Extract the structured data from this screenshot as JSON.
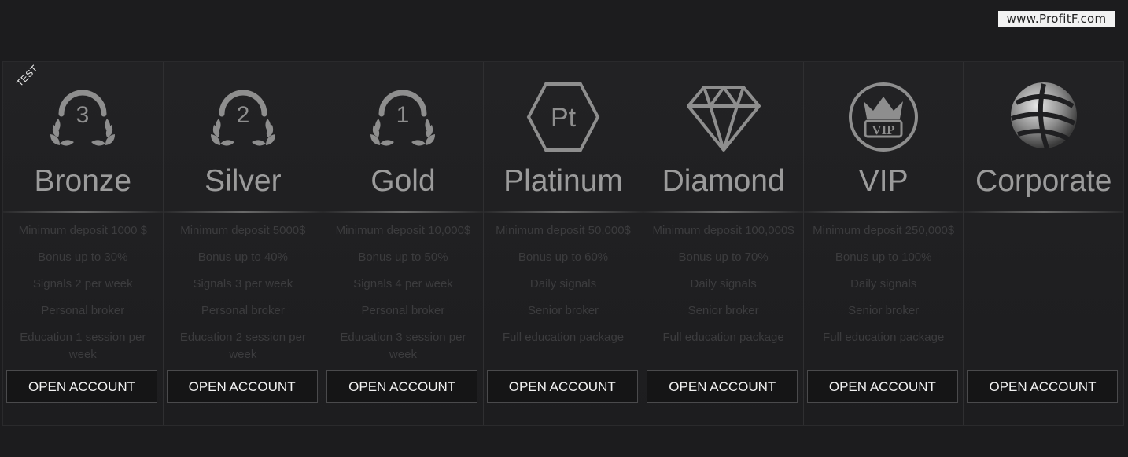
{
  "watermark": "www.ProfitF.com",
  "badge": "TEST",
  "colors": {
    "icon": "#8e8e8e",
    "text_dim": "#3c3c3e",
    "name": "#9b9b9b"
  },
  "plans": [
    {
      "name": "Bronze",
      "icon": "laurel-3-icon",
      "rank": "3",
      "features": [
        "Minimum deposit 1000 $",
        "Bonus up to 30%",
        "Signals 2 per week",
        "Personal broker",
        "Education 1 session per week"
      ],
      "button": "OPEN ACCOUNT"
    },
    {
      "name": "Silver",
      "icon": "laurel-2-icon",
      "rank": "2",
      "features": [
        "Minimum deposit 5000$",
        "Bonus up to 40%",
        "Signals 3 per week",
        "Personal broker",
        "Education 2 session per week"
      ],
      "button": "OPEN ACCOUNT"
    },
    {
      "name": "Gold",
      "icon": "laurel-1-icon",
      "rank": "1",
      "features": [
        "Minimum deposit 10,000$",
        "Bonus up to 50%",
        "Signals 4 per week",
        "Personal broker",
        "Education 3 session per week"
      ],
      "button": "OPEN ACCOUNT"
    },
    {
      "name": "Platinum",
      "icon": "platinum-hexagon-icon",
      "rank": "Pt",
      "features": [
        "Minimum deposit 50,000$",
        "Bonus up to 60%",
        "Daily signals",
        "Senior broker",
        "Full education package"
      ],
      "button": "OPEN ACCOUNT"
    },
    {
      "name": "Diamond",
      "icon": "diamond-icon",
      "features": [
        "Minimum deposit 100,000$",
        "Bonus up to 70%",
        "Daily signals",
        "Senior broker",
        "Full education package"
      ],
      "button": "OPEN ACCOUNT"
    },
    {
      "name": "VIP",
      "icon": "vip-crown-icon",
      "rank": "VIP",
      "features": [
        "Minimum deposit 250,000$",
        "Bonus up to 100%",
        "Daily signals",
        "Senior broker",
        "Full education package"
      ],
      "button": "OPEN ACCOUNT"
    },
    {
      "name": "Corporate",
      "icon": "corporate-sphere-icon",
      "features": [],
      "button": "OPEN ACCOUNT"
    }
  ]
}
